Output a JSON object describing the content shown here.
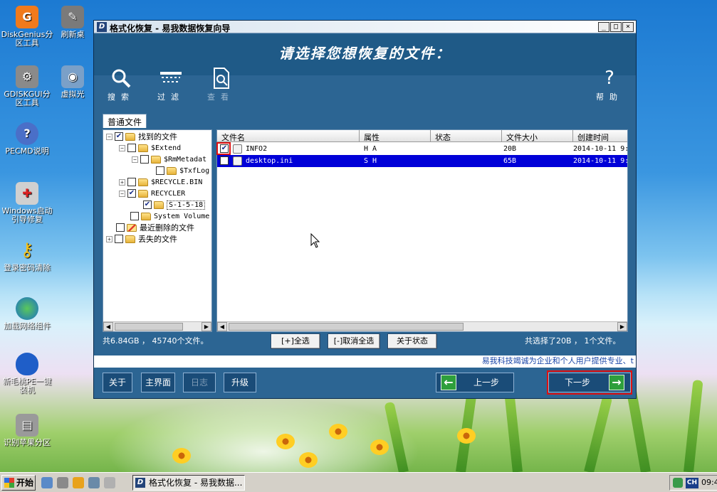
{
  "desktop": {
    "icons": [
      {
        "label": "DiskGenius分区工具",
        "color": "#f07a1c",
        "glyph": "G"
      },
      {
        "label": "刷新桌",
        "color": "#7a7a7a",
        "glyph": "✎"
      },
      {
        "label": "GDISKGUI分区工具",
        "color": "#8a8a8a",
        "glyph": "⚙"
      },
      {
        "label": "虚拟光",
        "color": "#7aa0c8",
        "glyph": "◉"
      },
      {
        "label": "PECMD说明",
        "color": "#4a6fc8",
        "glyph": "?"
      },
      {
        "label": "Windows启动引导修复",
        "color": "#c8c8c8",
        "glyph": "✚"
      },
      {
        "label": "登录密码清除",
        "color": "#e8b21c",
        "glyph": "⚷"
      },
      {
        "label": "加载网络组件",
        "color": "#2a8c3a",
        "glyph": "◍"
      },
      {
        "label": "新毛桃PE一键装机",
        "color": "#1f5ec8",
        "glyph": "●"
      },
      {
        "label": "识别苹果分区",
        "color": "#9a9a9a",
        "glyph": "▤"
      }
    ]
  },
  "window": {
    "app_icon": "D",
    "title": "格式化恢复 - 易我数据恢复向导",
    "controls": {
      "minimize": "_",
      "maximize": "□",
      "close": "×"
    },
    "banner_title": "请选择您想恢复的文件：",
    "toolbar": {
      "search": {
        "label": "搜索",
        "icon": "search-icon"
      },
      "filter": {
        "label": "过滤",
        "icon": "filter-icon"
      },
      "view": {
        "label": "查看",
        "icon": "view-icon"
      },
      "help": {
        "label": "帮助",
        "icon": "help-icon"
      }
    },
    "tab": "普通文件",
    "tree": [
      {
        "label": "找到的文件",
        "checked": true
      },
      {
        "label": "$Extend",
        "checked": false
      },
      {
        "label": "$RmMetadat",
        "checked": false
      },
      {
        "label": "$TxfLog",
        "checked": false
      },
      {
        "label": "$RECYCLE.BIN",
        "checked": false
      },
      {
        "label": "RECYCLER",
        "checked": true
      },
      {
        "label": "S-1-5-18",
        "checked": true
      },
      {
        "label": "System Volume",
        "checked": false
      },
      {
        "label": "最近删除的文件",
        "checked": false
      },
      {
        "label": "丢失的文件",
        "checked": false
      }
    ],
    "list": {
      "columns": [
        "文件名",
        "属性",
        "状态",
        "文件大小",
        "创建时间"
      ],
      "rows": [
        {
          "name": "INFO2",
          "attr": "H A",
          "state": "",
          "size": "20B",
          "created": "2014-10-11 9:",
          "checked": true
        },
        {
          "name": "desktop.ini",
          "attr": "S H",
          "state": "",
          "size": "65B",
          "created": "2014-10-11 9:",
          "checked": false
        }
      ]
    },
    "status_left": "共6.84GB ， 45740个文件。",
    "status_right": "共选择了20B ， 1个文件。",
    "buttons": {
      "select_all": "[+]全选",
      "deselect_all": "[-]取消全选",
      "about_state": "关于状态"
    },
    "marquee": "易我科技竭诚为企业和个人用户提供专业、t",
    "nav": {
      "about": "关于",
      "main": "主界面",
      "log": "日志",
      "upgrade": "升级",
      "prev": "上一步",
      "next": "下一步"
    }
  },
  "taskbar": {
    "start": "开始",
    "task": "格式化恢复 - 易我数据...",
    "task_icon": "D",
    "lang": "CH",
    "clock": "09:4"
  }
}
